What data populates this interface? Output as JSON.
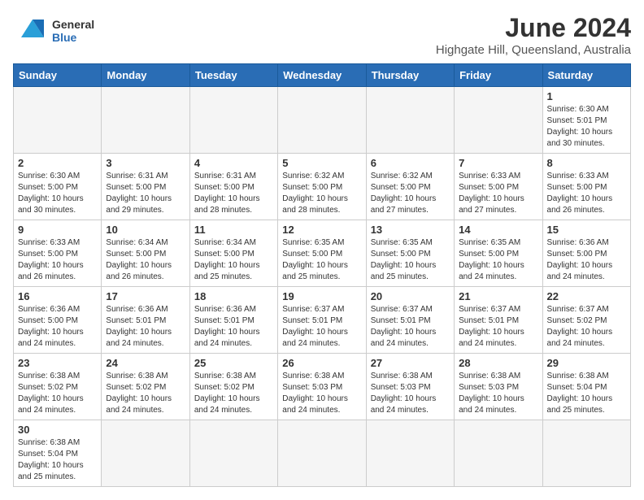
{
  "logo": {
    "line1": "General",
    "line2": "Blue"
  },
  "title": "June 2024",
  "subtitle": "Highgate Hill, Queensland, Australia",
  "days_of_week": [
    "Sunday",
    "Monday",
    "Tuesday",
    "Wednesday",
    "Thursday",
    "Friday",
    "Saturday"
  ],
  "weeks": [
    [
      {
        "day": "",
        "info": ""
      },
      {
        "day": "",
        "info": ""
      },
      {
        "day": "",
        "info": ""
      },
      {
        "day": "",
        "info": ""
      },
      {
        "day": "",
        "info": ""
      },
      {
        "day": "",
        "info": ""
      },
      {
        "day": "1",
        "info": "Sunrise: 6:30 AM\nSunset: 5:01 PM\nDaylight: 10 hours\nand 30 minutes."
      }
    ],
    [
      {
        "day": "2",
        "info": "Sunrise: 6:30 AM\nSunset: 5:00 PM\nDaylight: 10 hours\nand 30 minutes."
      },
      {
        "day": "3",
        "info": "Sunrise: 6:31 AM\nSunset: 5:00 PM\nDaylight: 10 hours\nand 29 minutes."
      },
      {
        "day": "4",
        "info": "Sunrise: 6:31 AM\nSunset: 5:00 PM\nDaylight: 10 hours\nand 28 minutes."
      },
      {
        "day": "5",
        "info": "Sunrise: 6:32 AM\nSunset: 5:00 PM\nDaylight: 10 hours\nand 28 minutes."
      },
      {
        "day": "6",
        "info": "Sunrise: 6:32 AM\nSunset: 5:00 PM\nDaylight: 10 hours\nand 27 minutes."
      },
      {
        "day": "7",
        "info": "Sunrise: 6:33 AM\nSunset: 5:00 PM\nDaylight: 10 hours\nand 27 minutes."
      },
      {
        "day": "8",
        "info": "Sunrise: 6:33 AM\nSunset: 5:00 PM\nDaylight: 10 hours\nand 26 minutes."
      }
    ],
    [
      {
        "day": "9",
        "info": "Sunrise: 6:33 AM\nSunset: 5:00 PM\nDaylight: 10 hours\nand 26 minutes."
      },
      {
        "day": "10",
        "info": "Sunrise: 6:34 AM\nSunset: 5:00 PM\nDaylight: 10 hours\nand 26 minutes."
      },
      {
        "day": "11",
        "info": "Sunrise: 6:34 AM\nSunset: 5:00 PM\nDaylight: 10 hours\nand 25 minutes."
      },
      {
        "day": "12",
        "info": "Sunrise: 6:35 AM\nSunset: 5:00 PM\nDaylight: 10 hours\nand 25 minutes."
      },
      {
        "day": "13",
        "info": "Sunrise: 6:35 AM\nSunset: 5:00 PM\nDaylight: 10 hours\nand 25 minutes."
      },
      {
        "day": "14",
        "info": "Sunrise: 6:35 AM\nSunset: 5:00 PM\nDaylight: 10 hours\nand 24 minutes."
      },
      {
        "day": "15",
        "info": "Sunrise: 6:36 AM\nSunset: 5:00 PM\nDaylight: 10 hours\nand 24 minutes."
      }
    ],
    [
      {
        "day": "16",
        "info": "Sunrise: 6:36 AM\nSunset: 5:00 PM\nDaylight: 10 hours\nand 24 minutes."
      },
      {
        "day": "17",
        "info": "Sunrise: 6:36 AM\nSunset: 5:01 PM\nDaylight: 10 hours\nand 24 minutes."
      },
      {
        "day": "18",
        "info": "Sunrise: 6:36 AM\nSunset: 5:01 PM\nDaylight: 10 hours\nand 24 minutes."
      },
      {
        "day": "19",
        "info": "Sunrise: 6:37 AM\nSunset: 5:01 PM\nDaylight: 10 hours\nand 24 minutes."
      },
      {
        "day": "20",
        "info": "Sunrise: 6:37 AM\nSunset: 5:01 PM\nDaylight: 10 hours\nand 24 minutes."
      },
      {
        "day": "21",
        "info": "Sunrise: 6:37 AM\nSunset: 5:01 PM\nDaylight: 10 hours\nand 24 minutes."
      },
      {
        "day": "22",
        "info": "Sunrise: 6:37 AM\nSunset: 5:02 PM\nDaylight: 10 hours\nand 24 minutes."
      }
    ],
    [
      {
        "day": "23",
        "info": "Sunrise: 6:38 AM\nSunset: 5:02 PM\nDaylight: 10 hours\nand 24 minutes."
      },
      {
        "day": "24",
        "info": "Sunrise: 6:38 AM\nSunset: 5:02 PM\nDaylight: 10 hours\nand 24 minutes."
      },
      {
        "day": "25",
        "info": "Sunrise: 6:38 AM\nSunset: 5:02 PM\nDaylight: 10 hours\nand 24 minutes."
      },
      {
        "day": "26",
        "info": "Sunrise: 6:38 AM\nSunset: 5:03 PM\nDaylight: 10 hours\nand 24 minutes."
      },
      {
        "day": "27",
        "info": "Sunrise: 6:38 AM\nSunset: 5:03 PM\nDaylight: 10 hours\nand 24 minutes."
      },
      {
        "day": "28",
        "info": "Sunrise: 6:38 AM\nSunset: 5:03 PM\nDaylight: 10 hours\nand 24 minutes."
      },
      {
        "day": "29",
        "info": "Sunrise: 6:38 AM\nSunset: 5:04 PM\nDaylight: 10 hours\nand 25 minutes."
      }
    ],
    [
      {
        "day": "30",
        "info": "Sunrise: 6:38 AM\nSunset: 5:04 PM\nDaylight: 10 hours\nand 25 minutes."
      },
      {
        "day": "",
        "info": ""
      },
      {
        "day": "",
        "info": ""
      },
      {
        "day": "",
        "info": ""
      },
      {
        "day": "",
        "info": ""
      },
      {
        "day": "",
        "info": ""
      },
      {
        "day": "",
        "info": ""
      }
    ]
  ]
}
